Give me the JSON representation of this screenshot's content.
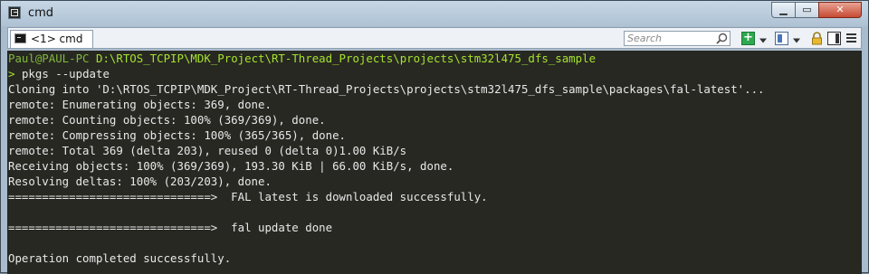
{
  "window": {
    "title": "cmd",
    "minimize_glyph": "▁",
    "maximize_glyph": "▭",
    "close_glyph": "✕"
  },
  "tab": {
    "label": "<1> cmd"
  },
  "search": {
    "placeholder": "Search"
  },
  "toolbar_icons": [
    "add-icon",
    "chevron-down-icon",
    "split-icon",
    "chevron-down-icon",
    "lock-icon",
    "layout-icon",
    "menu-icon"
  ],
  "colors": {
    "console_bg": "#272822",
    "console_text": "#e8e8e8",
    "prompt_user": "#82b83c",
    "prompt_path": "#a6e22e"
  },
  "console": {
    "prompt": {
      "user": "Paul@PAUL-PC",
      "path": "D:\\RTOS_TCPIP\\MDK_Project\\RT-Thread_Projects\\projects\\stm32l475_dfs_sample"
    },
    "command_arrow": ">",
    "command": "pkgs --update",
    "output": [
      "Cloning into 'D:\\RTOS_TCPIP\\MDK_Project\\RT-Thread_Projects\\projects\\stm32l475_dfs_sample\\packages\\fal-latest'...",
      "remote: Enumerating objects: 369, done.",
      "remote: Counting objects: 100% (369/369), done.",
      "remote: Compressing objects: 100% (365/365), done.",
      "remote: Total 369 (delta 203), reused 0 (delta 0)1.00 KiB/s",
      "Receiving objects: 100% (369/369), 193.30 KiB | 66.00 KiB/s, done.",
      "Resolving deltas: 100% (203/203), done.",
      "==============================>  FAL latest is downloaded successfully.",
      "",
      "==============================>  fal update done",
      "",
      "Operation completed successfully."
    ]
  }
}
